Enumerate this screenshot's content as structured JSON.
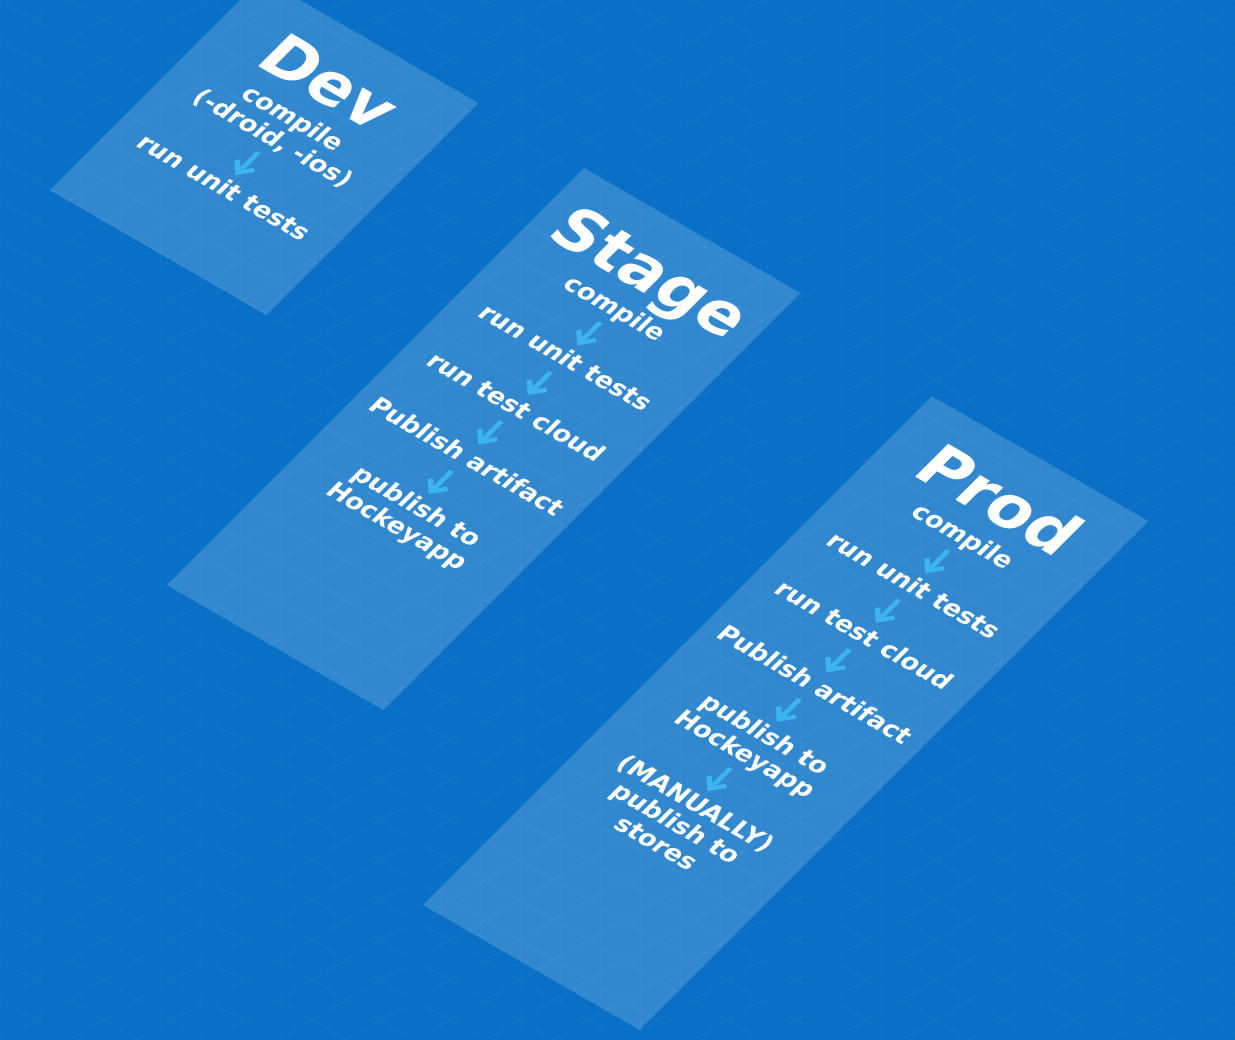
{
  "colors": {
    "background": "#0870c6",
    "panel": "rgba(255,255,255,0.17)",
    "arrow": "#3db4f2",
    "text": "#ffffff"
  },
  "environments": [
    {
      "title": "Dev",
      "steps": [
        "compile\n(-droid, -ios)",
        "run unit tests"
      ]
    },
    {
      "title": "Stage",
      "steps": [
        "compile",
        "run unit tests",
        "run test cloud",
        "Publish artifact",
        "publish to\nHockeyapp"
      ]
    },
    {
      "title": "Prod",
      "steps": [
        "compile",
        "run unit tests",
        "run test cloud",
        "Publish artifact",
        "publish to\nHockeyapp",
        "(MANUALLY)\npublish to\nstores"
      ]
    }
  ]
}
